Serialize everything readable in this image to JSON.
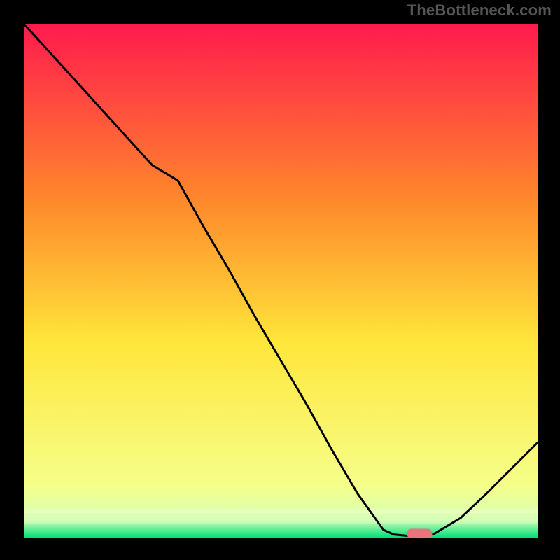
{
  "source_label": "TheBottleneck.com",
  "chart_data": {
    "type": "line",
    "title": "",
    "xlabel": "",
    "ylabel": "",
    "xlim": [
      0,
      1
    ],
    "ylim": [
      0,
      1
    ],
    "grid": false,
    "legend": false,
    "background_gradient": {
      "top": "#ff1a4d",
      "upper_mid": "#ff8a2b",
      "mid": "#ffe63b",
      "lower_mid": "#f5ff8a",
      "bottom": "#00e07a"
    },
    "curve": {
      "color": "#000000",
      "width": 3,
      "x": [
        0.0,
        0.05,
        0.1,
        0.15,
        0.2,
        0.25,
        0.3,
        0.35,
        0.4,
        0.45,
        0.5,
        0.55,
        0.6,
        0.65,
        0.7,
        0.72,
        0.75,
        0.78,
        0.8,
        0.85,
        0.9,
        0.95,
        1.0
      ],
      "y": [
        1.0,
        0.945,
        0.89,
        0.835,
        0.78,
        0.725,
        0.695,
        0.605,
        0.52,
        0.43,
        0.345,
        0.26,
        0.17,
        0.085,
        0.015,
        0.006,
        0.003,
        0.003,
        0.008,
        0.038,
        0.085,
        0.135,
        0.185
      ]
    },
    "marker": {
      "color": "#e9747e",
      "shape": "rounded-bar",
      "x_start": 0.745,
      "x_end": 0.795,
      "y": 0.008,
      "thickness": 0.018
    }
  }
}
